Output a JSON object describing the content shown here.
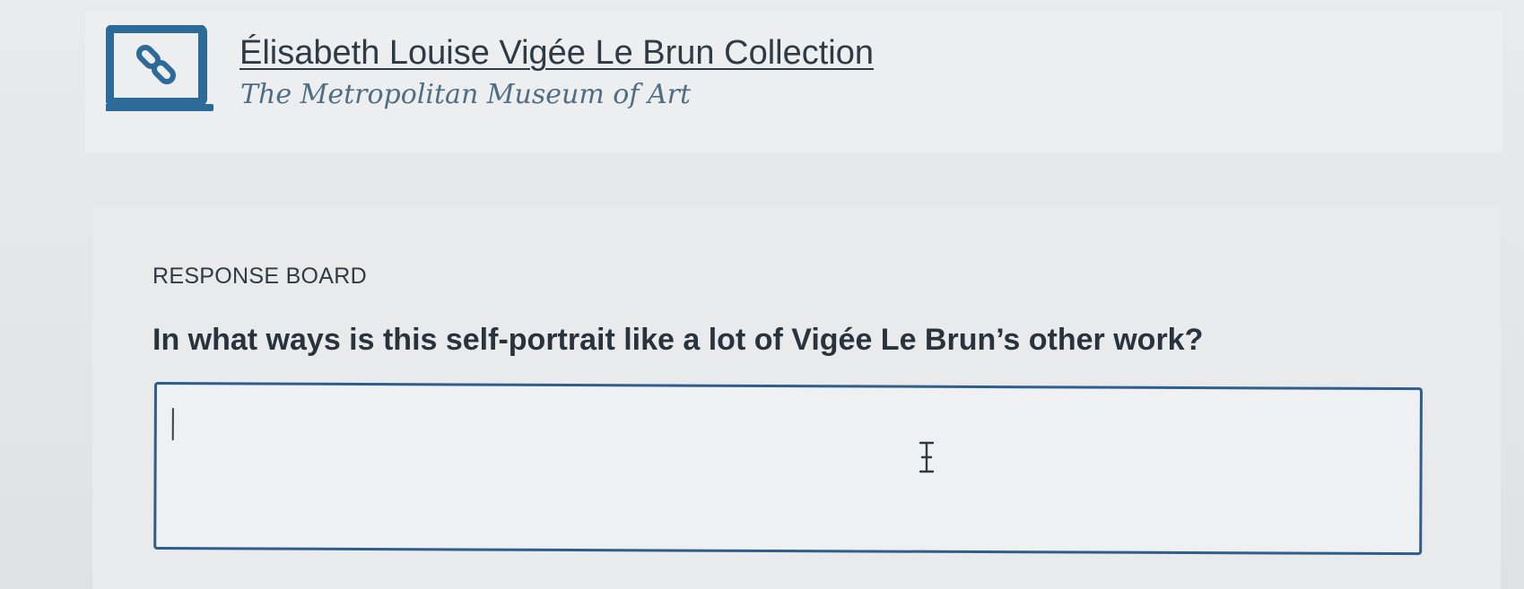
{
  "header": {
    "title": "Élisabeth Louise Vigée Le Brun Collection",
    "subtitle": "The Metropolitan Museum of Art",
    "icon": "link-laptop-icon"
  },
  "response_board": {
    "section_label": "RESPONSE BOARD",
    "question": "In what ways is this self-portrait like a lot of Vigée Le Brun’s other work?",
    "answer_value": "",
    "cursor_icon": "text-ibeam-cursor-icon"
  },
  "colors": {
    "accent_border": "#2f5d8c",
    "icon_blue": "#2b6a99",
    "subtitle_blue": "#4f6d83",
    "text_dark": "#29333d"
  }
}
